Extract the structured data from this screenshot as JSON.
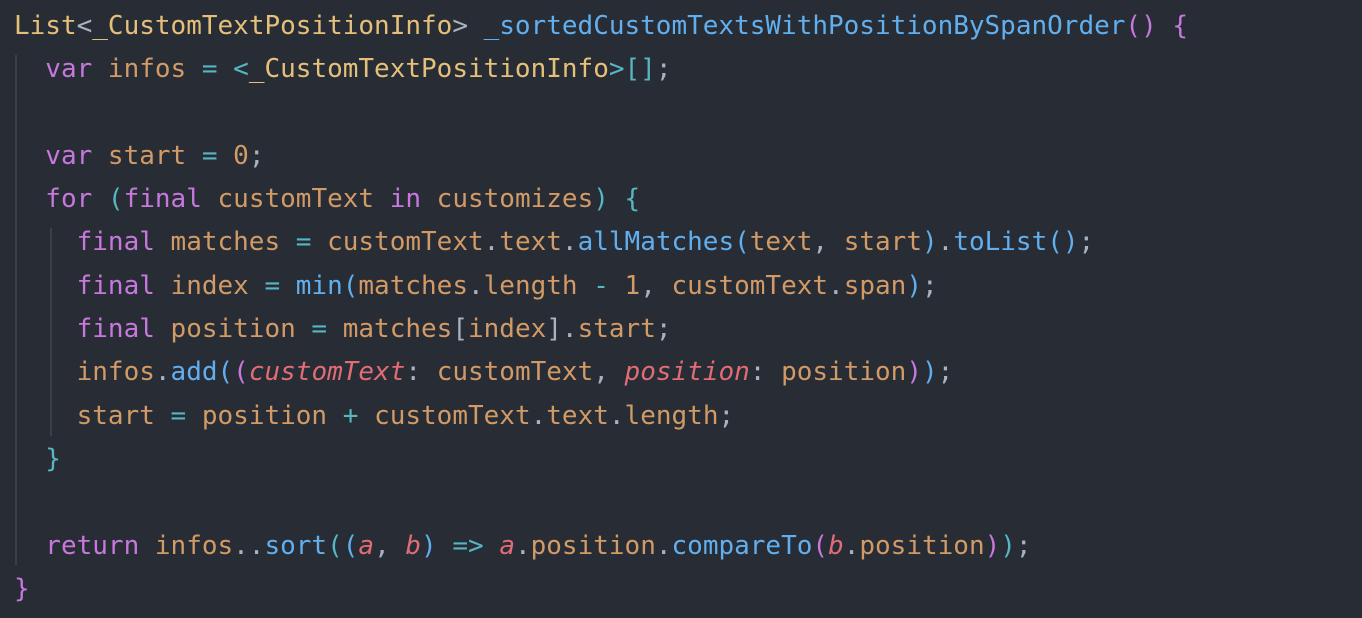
{
  "code": {
    "l1": {
      "t1": "List",
      "t2": "<",
      "t3": "_CustomTextPositionInfo",
      "t4": "> ",
      "t5": "_sortedCustomTextsWithPositionBySpanOrder",
      "t6": "()",
      "t7": " {"
    },
    "l2": {
      "t1": "  var",
      "t2": " infos",
      "t3": " = ",
      "t4": "<",
      "t5": "_CustomTextPositionInfo",
      "t6": ">",
      "t7": "[]",
      "t8": ";"
    },
    "l3": {
      "t1": ""
    },
    "l4": {
      "t1": "  var",
      "t2": " start",
      "t3": " = ",
      "t4": "0",
      "t5": ";"
    },
    "l5": {
      "t1": "  for",
      "t2": " (",
      "t3": "final",
      "t4": " customText",
      "t5": " in",
      "t6": " customizes",
      "t7": ")",
      "t8": " {"
    },
    "l6": {
      "t1": "    final",
      "t2": " matches",
      "t3": " = ",
      "t4": "customText",
      "t5": ".",
      "t6": "text",
      "t7": ".",
      "t8": "allMatches",
      "t9": "(",
      "t10": "text",
      "t11": ", ",
      "t12": "start",
      "t13": ")",
      "t14": ".",
      "t15": "toList",
      "t16": "()",
      "t17": ";"
    },
    "l7": {
      "t1": "    final",
      "t2": " index",
      "t3": " = ",
      "t4": "min",
      "t5": "(",
      "t6": "matches",
      "t7": ".",
      "t8": "length",
      "t9": " - ",
      "t10": "1",
      "t11": ", ",
      "t12": "customText",
      "t13": ".",
      "t14": "span",
      "t15": ")",
      "t16": ";"
    },
    "l8": {
      "t1": "    final",
      "t2": " position",
      "t3": " = ",
      "t4": "matches",
      "t5": "[",
      "t6": "index",
      "t7": "]",
      "t8": ".",
      "t9": "start",
      "t10": ";"
    },
    "l9": {
      "t1": "    infos",
      "t2": ".",
      "t3": "add",
      "t4": "(",
      "t5": "(",
      "t6": "customText",
      "t7": ": ",
      "t8": "customText",
      "t9": ", ",
      "t10": "position",
      "t11": ": ",
      "t12": "position",
      "t13": ")",
      "t14": ")",
      "t15": ";"
    },
    "l10": {
      "t1": "    start",
      "t2": " = ",
      "t3": "position",
      "t4": " + ",
      "t5": "customText",
      "t6": ".",
      "t7": "text",
      "t8": ".",
      "t9": "length",
      "t10": ";"
    },
    "l11": {
      "t1": "  }"
    },
    "l12": {
      "t1": ""
    },
    "l13": {
      "t1": "  return",
      "t2": " infos",
      "t3": "..",
      "t4": "sort",
      "t5": "(",
      "t6": "(",
      "t7": "a",
      "t8": ", ",
      "t9": "b",
      "t10": ")",
      "t11": " => ",
      "t12": "a",
      "t13": ".",
      "t14": "position",
      "t15": ".",
      "t16": "compareTo",
      "t17": "(",
      "t18": "b",
      "t19": ".",
      "t20": "position",
      "t21": ")",
      "t22": ")",
      "t23": ";"
    },
    "l14": {
      "t1": "}"
    }
  }
}
